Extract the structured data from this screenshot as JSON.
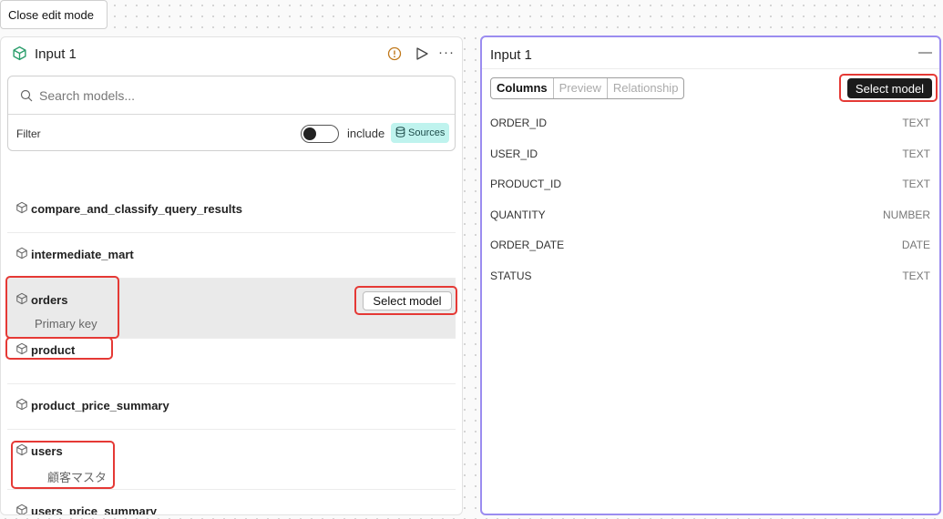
{
  "toolbar": {
    "close_edit_label": "Close edit mode"
  },
  "left_panel": {
    "title": "Input 1",
    "icons": {
      "title": "cube-icon",
      "warning": "warning-icon",
      "run": "play-icon",
      "more": "more-icon"
    },
    "more_glyph": "···",
    "search": {
      "placeholder": "Search models...",
      "value": ""
    },
    "filter": {
      "label": "Filter",
      "toggle_on": false,
      "include_label": "include",
      "sources_label": "Sources"
    },
    "models": [
      {
        "name": "compare_and_classify_query_results",
        "description": ""
      },
      {
        "name": "intermediate_mart",
        "description": ""
      },
      {
        "name": "orders",
        "description": "Primary key",
        "select_label": "Select model"
      },
      {
        "name": "product",
        "description": ""
      },
      {
        "name": "product_price_summary",
        "description": ""
      },
      {
        "name": "users",
        "description": "顧客マスタ"
      },
      {
        "name": "users_price_summary",
        "description": ""
      }
    ]
  },
  "right_panel": {
    "title": "Input 1",
    "minimize_glyph": "—",
    "tabs": [
      "Columns",
      "Preview",
      "Relationship"
    ],
    "active_tab": "Columns",
    "select_label": "Select model",
    "columns": [
      {
        "name": "ORDER_ID",
        "type": "TEXT"
      },
      {
        "name": "USER_ID",
        "type": "TEXT"
      },
      {
        "name": "PRODUCT_ID",
        "type": "TEXT"
      },
      {
        "name": "QUANTITY",
        "type": "NUMBER"
      },
      {
        "name": "ORDER_DATE",
        "type": "DATE"
      },
      {
        "name": "STATUS",
        "type": "TEXT"
      }
    ]
  },
  "colors": {
    "accent_border": "#9b8cf0",
    "highlight": "#e53935",
    "sources_badge": "#bff3ee",
    "cube_green": "#2a9d6b",
    "warning": "#c0781a"
  }
}
